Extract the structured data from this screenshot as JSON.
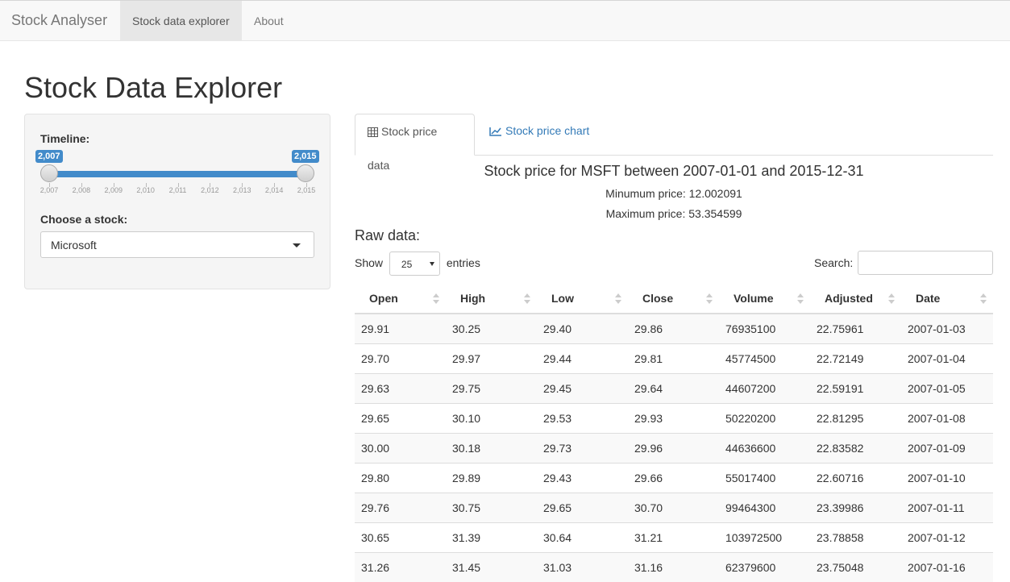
{
  "navbar": {
    "brand": "Stock Analyser",
    "items": [
      {
        "label": "Stock data explorer",
        "active": true
      },
      {
        "label": "About",
        "active": false
      }
    ]
  },
  "page_title": "Stock Data Explorer",
  "sidebar": {
    "timeline_label": "Timeline:",
    "slider": {
      "from": "2,007",
      "to": "2,015",
      "ticks": [
        "2,007",
        "2,008",
        "2,009",
        "2,010",
        "2,011",
        "2,012",
        "2,013",
        "2,014",
        "2,015"
      ]
    },
    "stock_label": "Choose a stock:",
    "stock_selected": "Microsoft"
  },
  "tabs": [
    {
      "label": "Stock price data",
      "icon": "table-icon",
      "active": true
    },
    {
      "label": "Stock price chart",
      "icon": "line-chart-icon",
      "active": false
    }
  ],
  "summary": {
    "title": "Stock price for MSFT between 2007-01-01 and 2015-12-31",
    "min": "Minumum price: 12.002091",
    "max": "Maximum price: 53.354599"
  },
  "raw": {
    "title": "Raw data:",
    "show_label": "Show",
    "entries_value": "25",
    "entries_label": "entries",
    "search_label": "Search:",
    "search_value": ""
  },
  "colors": {
    "accent": "#428bca",
    "link": "#337ab7"
  },
  "table": {
    "columns": [
      "Open",
      "High",
      "Low",
      "Close",
      "Volume",
      "Adjusted",
      "Date"
    ],
    "rows": [
      [
        "29.91",
        "30.25",
        "29.40",
        "29.86",
        "76935100",
        "22.75961",
        "2007-01-03"
      ],
      [
        "29.70",
        "29.97",
        "29.44",
        "29.81",
        "45774500",
        "22.72149",
        "2007-01-04"
      ],
      [
        "29.63",
        "29.75",
        "29.45",
        "29.64",
        "44607200",
        "22.59191",
        "2007-01-05"
      ],
      [
        "29.65",
        "30.10",
        "29.53",
        "29.93",
        "50220200",
        "22.81295",
        "2007-01-08"
      ],
      [
        "30.00",
        "30.18",
        "29.73",
        "29.96",
        "44636600",
        "22.83582",
        "2007-01-09"
      ],
      [
        "29.80",
        "29.89",
        "29.43",
        "29.66",
        "55017400",
        "22.60716",
        "2007-01-10"
      ],
      [
        "29.76",
        "30.75",
        "29.65",
        "30.70",
        "99464300",
        "23.39986",
        "2007-01-11"
      ],
      [
        "30.65",
        "31.39",
        "30.64",
        "31.21",
        "103972500",
        "23.78858",
        "2007-01-12"
      ],
      [
        "31.26",
        "31.45",
        "31.03",
        "31.16",
        "62379600",
        "23.75048",
        "2007-01-16"
      ]
    ]
  }
}
